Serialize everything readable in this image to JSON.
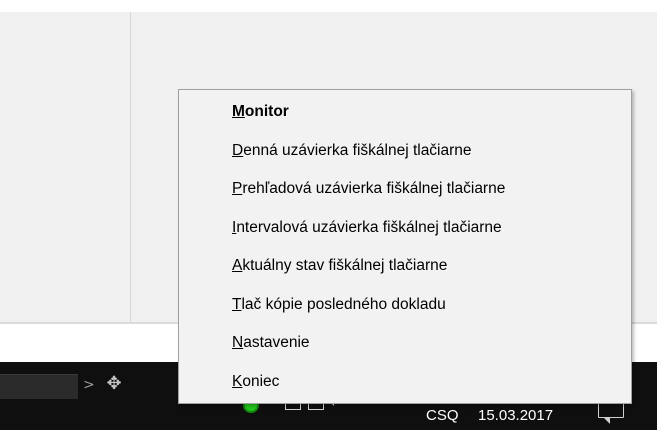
{
  "context_menu": {
    "items": [
      {
        "mnemonic": "M",
        "rest": "onitor",
        "bold": true
      },
      {
        "mnemonic": "D",
        "rest": "enná uzávierka fiškálnej tlačiarne",
        "bold": false
      },
      {
        "mnemonic": "P",
        "rest": "rehľadová uzávierka fiškálnej tlačiarne",
        "bold": false
      },
      {
        "mnemonic": "I",
        "rest": "ntervalová uzávierka fiškálnej tlačiarne",
        "bold": false
      },
      {
        "mnemonic": "A",
        "rest": "ktuálny stav fiškálnej tlačiarne",
        "bold": false
      },
      {
        "mnemonic": "T",
        "rest": "lač kópie posledného dokladu",
        "bold": false
      },
      {
        "mnemonic": "N",
        "rest": "astavenie",
        "bold": false
      },
      {
        "mnemonic": "K",
        "rest": "oniec",
        "bold": false
      }
    ]
  },
  "taskbar": {
    "chevron_icon": "chevron-right-icon",
    "move_icon": "move-arrows-icon",
    "tray_chevron_icon": "chevron-up-icon",
    "status_indicator_color": "#21c51d",
    "language": "CSQ",
    "date": "15.03.2017"
  },
  "colors": {
    "taskbar_bg": "#0f0f0f",
    "menu_bg": "#f2f2f2",
    "menu_border": "#a0a0a0"
  }
}
